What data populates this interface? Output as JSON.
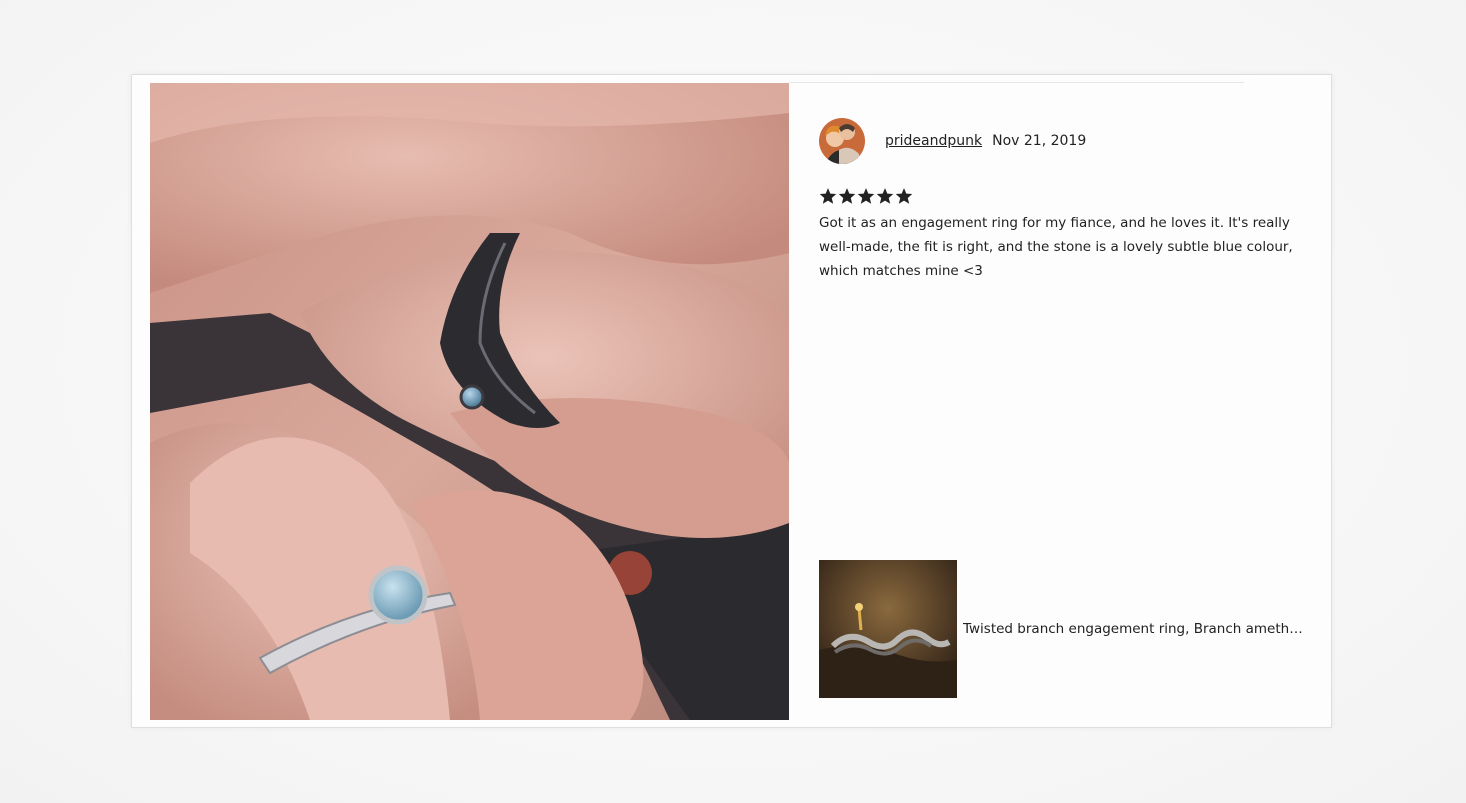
{
  "review": {
    "username": "prideandpunk",
    "date": "Nov 21, 2019",
    "rating": 5,
    "rating_max": 5,
    "text": "Got it as an engagement ring for my fiance, and he loves it. It's really well-made, the fit is right, and the stone is a lovely subtle blue colour, which matches mine <3"
  },
  "listing": {
    "title": "Twisted branch engagement ring, Branch amethy..."
  },
  "icons": {
    "star": "star-icon"
  },
  "colors": {
    "text": "#222222",
    "star": "#222222",
    "card_border": "#dedede"
  }
}
